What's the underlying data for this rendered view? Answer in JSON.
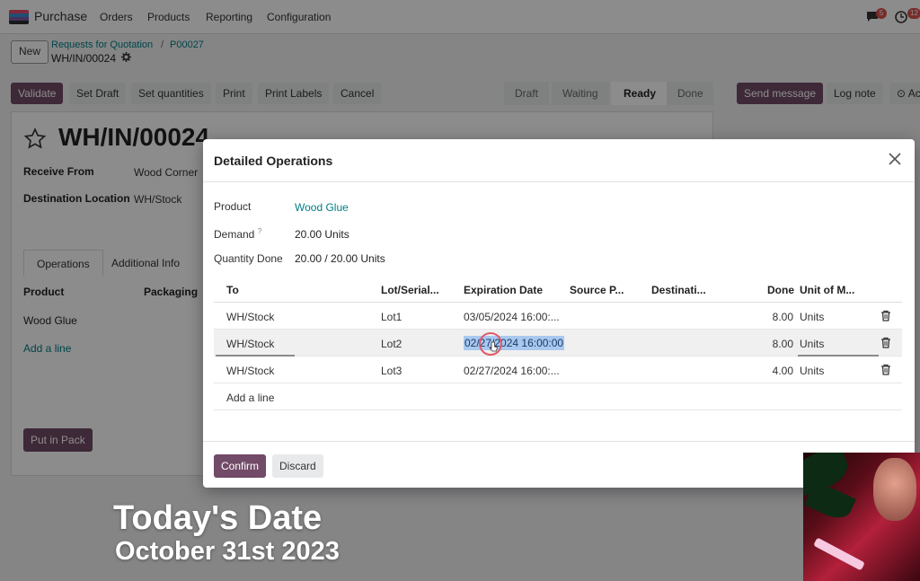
{
  "topnav": {
    "app_name": "Purchase",
    "menu": [
      "Orders",
      "Products",
      "Reporting",
      "Configuration"
    ],
    "chat_badge": "5",
    "activity_badge": "12",
    "logo_colors": [
      "#e84c6b",
      "#3b8fd6",
      "#7b5ea7",
      "#2d2d2d"
    ]
  },
  "breadcrumb": {
    "new_label": "New",
    "parent": "Requests for Quotation",
    "separator": "/",
    "po": "P00027",
    "record": "WH/IN/00024"
  },
  "actions": {
    "validate": "Validate",
    "set_draft": "Set Draft",
    "set_quantities": "Set quantities",
    "print": "Print",
    "print_labels": "Print Labels",
    "cancel": "Cancel"
  },
  "status": [
    "Draft",
    "Waiting",
    "Ready",
    "Done"
  ],
  "status_active": "Ready",
  "chatter": {
    "send_message": "Send message",
    "log_note": "Log note",
    "activities": "Ac"
  },
  "record": {
    "title": "WH/IN/00024",
    "receive_from_label": "Receive From",
    "receive_from": "Wood Corner",
    "destination_label": "Destination Location",
    "destination": "WH/Stock",
    "tabs": [
      "Operations",
      "Additional Info"
    ],
    "col_product": "Product",
    "col_packaging": "Packaging",
    "line_product": "Wood Glue",
    "add_line": "Add a line",
    "put_in_pack": "Put in Pack"
  },
  "modal": {
    "title": "Detailed Operations",
    "product_label": "Product",
    "product": "Wood Glue",
    "demand_label": "Demand",
    "demand_hint": "?",
    "demand": "20.00 Units",
    "qty_done_label": "Quantity Done",
    "qty_done": "20.00 / 20.00 Units",
    "columns": [
      "To",
      "Lot/Serial...",
      "Expiration Date",
      "Source P...",
      "Destinati...",
      "Done",
      "Unit of M..."
    ],
    "rows": [
      {
        "to": "WH/Stock",
        "lot": "Lot1",
        "expiration": "03/05/2024 16:00:...",
        "done": "8.00",
        "uom": "Units"
      },
      {
        "to": "WH/Stock",
        "lot": "Lot2",
        "expiration": "02/27/2024 16:00:00",
        "done": "8.00",
        "uom": "Units"
      },
      {
        "to": "WH/Stock",
        "lot": "Lot3",
        "expiration": "02/27/2024 16:00:...",
        "done": "4.00",
        "uom": "Units"
      }
    ],
    "add_line": "Add a line",
    "confirm": "Confirm",
    "discard": "Discard"
  },
  "caption": {
    "line1": "Today's Date",
    "line2": "October 31st 2023"
  },
  "colors": {
    "primary": "#714b67",
    "link": "#017e84",
    "selection": "#a9c8ef"
  }
}
